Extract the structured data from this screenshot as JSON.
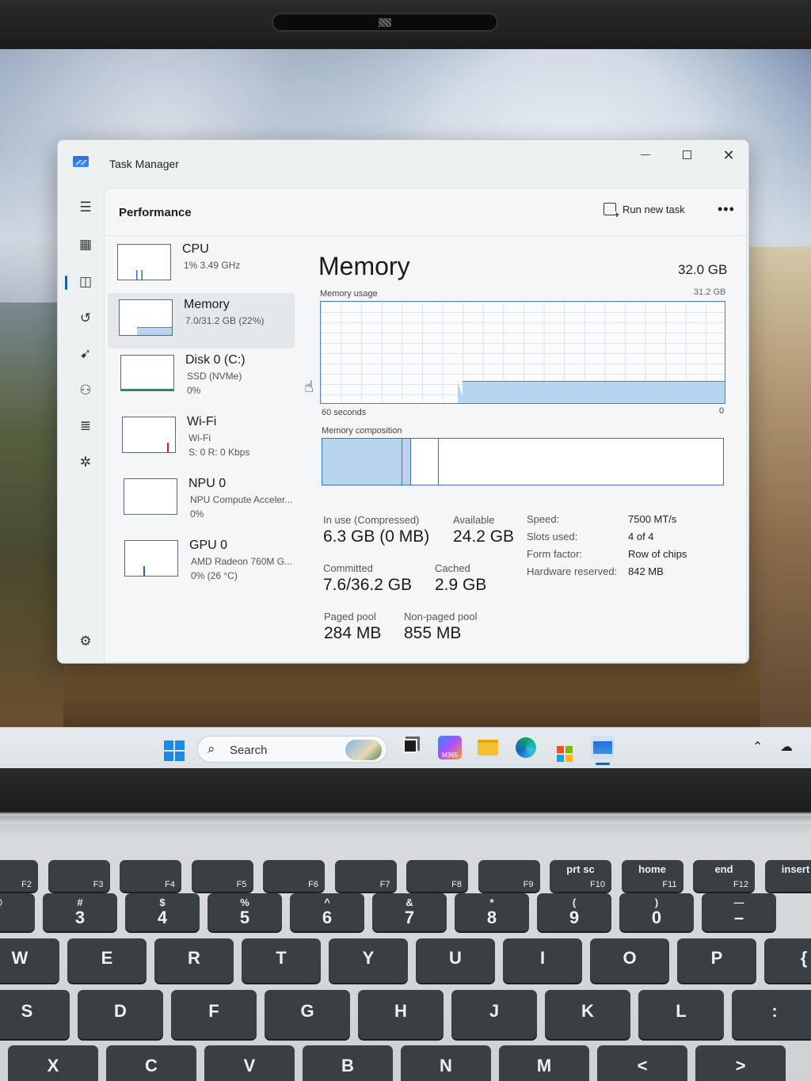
{
  "window": {
    "title": "Task Manager",
    "page_title": "Performance",
    "run_new_task": "Run new task",
    "more": "•••"
  },
  "rail": [
    {
      "icon": "hamburger-menu-icon",
      "glyph": "☰"
    },
    {
      "icon": "processes-icon",
      "glyph": "▦"
    },
    {
      "icon": "performance-icon",
      "glyph": "◫"
    },
    {
      "icon": "app-history-icon",
      "glyph": "↺"
    },
    {
      "icon": "startup-apps-icon",
      "glyph": "➹"
    },
    {
      "icon": "users-icon",
      "glyph": "⚇"
    },
    {
      "icon": "details-icon",
      "glyph": "≣"
    },
    {
      "icon": "services-icon",
      "glyph": "✲"
    },
    {
      "icon": "settings-icon",
      "glyph": "⚙"
    }
  ],
  "resources": [
    {
      "name": "CPU",
      "line1": "1% 3.49 GHz",
      "line2": ""
    },
    {
      "name": "Memory",
      "line1": "7.0/31.2 GB (22%)",
      "line2": "",
      "usage_fraction": 0.22
    },
    {
      "name": "Disk 0 (C:)",
      "line1": "SSD (NVMe)",
      "line2": "0%"
    },
    {
      "name": "Wi-Fi",
      "line1": "Wi-Fi",
      "line2": "S: 0 R: 0 Kbps"
    },
    {
      "name": "NPU 0",
      "line1": "NPU Compute Acceler...",
      "line2": "0%"
    },
    {
      "name": "GPU 0",
      "line1": "AMD Radeon 760M G...",
      "line2": "0% (26 °C)"
    }
  ],
  "memory": {
    "title": "Memory",
    "total": "32.0 GB",
    "usage_label": "Memory usage",
    "usage_max": "31.2 GB",
    "axis_left": "60 seconds",
    "axis_right": "0",
    "usage_history_fraction": 0.22,
    "usage_start_fraction": 0.34,
    "composition_label": "Memory composition",
    "composition_fractions": {
      "in_use": 0.2,
      "modified": 0.022,
      "standby": 0.07,
      "free": 0.708
    },
    "stats": {
      "in_use_label": "In use (Compressed)",
      "in_use_value": "6.3 GB (0 MB)",
      "available_label": "Available",
      "available_value": "24.2 GB",
      "committed_label": "Committed",
      "committed_value": "7.6/36.2 GB",
      "cached_label": "Cached",
      "cached_value": "2.9 GB",
      "paged_label": "Paged pool",
      "paged_value": "284 MB",
      "nonpaged_label": "Non-paged pool",
      "nonpaged_value": "855 MB"
    },
    "specs": {
      "speed_label": "Speed:",
      "speed_value": "7500 MT/s",
      "slots_label": "Slots used:",
      "slots_value": "4 of 4",
      "form_label": "Form factor:",
      "form_value": "Row of chips",
      "reserved_label": "Hardware reserved:",
      "reserved_value": "842 MB"
    }
  },
  "taskbar": {
    "search_placeholder": "Search",
    "apps": [
      "task-view-icon",
      "m365-copilot-icon",
      "file-explorer-icon",
      "edge-icon",
      "microsoft-store-icon",
      "task-manager-icon"
    ],
    "m365_label": "M365"
  },
  "keyboard": {
    "fn_row": [
      {
        "fn": "F2"
      },
      {
        "fn": "F3"
      },
      {
        "fn": "F4"
      },
      {
        "fn": "F5"
      },
      {
        "fn": "F6"
      },
      {
        "fn": "F7"
      },
      {
        "fn": "F8"
      },
      {
        "fn": "F9"
      },
      {
        "top": "prt sc",
        "fn": "F10"
      },
      {
        "top": "home",
        "fn": "F11"
      },
      {
        "top": "end",
        "fn": "F12"
      },
      {
        "top": "insert",
        "fn": ""
      }
    ],
    "num_row": [
      {
        "top": "@",
        "main": ""
      },
      {
        "top": "#",
        "main": "3"
      },
      {
        "top": "$",
        "main": "4"
      },
      {
        "top": "%",
        "main": "5"
      },
      {
        "top": "^",
        "main": "6"
      },
      {
        "top": "&",
        "main": "7"
      },
      {
        "top": "*",
        "main": "8"
      },
      {
        "top": "(",
        "main": "9"
      },
      {
        "top": ")",
        "main": "0"
      },
      {
        "top": "—",
        "main": "–"
      }
    ],
    "qwerty_row": [
      "W",
      "E",
      "R",
      "T",
      "Y",
      "U",
      "I",
      "O",
      "P",
      "{"
    ],
    "home_row": [
      "S",
      "D",
      "F",
      "G",
      "H",
      "J",
      "K",
      "L",
      ":"
    ],
    "bottom_row": [
      "X",
      "C",
      "V",
      "B",
      "N",
      "M",
      "<",
      ">"
    ]
  },
  "colors": {
    "accent": "#1a5fb4",
    "memory_fill": "#b8d4ee",
    "memory_line": "#4a86c8"
  }
}
